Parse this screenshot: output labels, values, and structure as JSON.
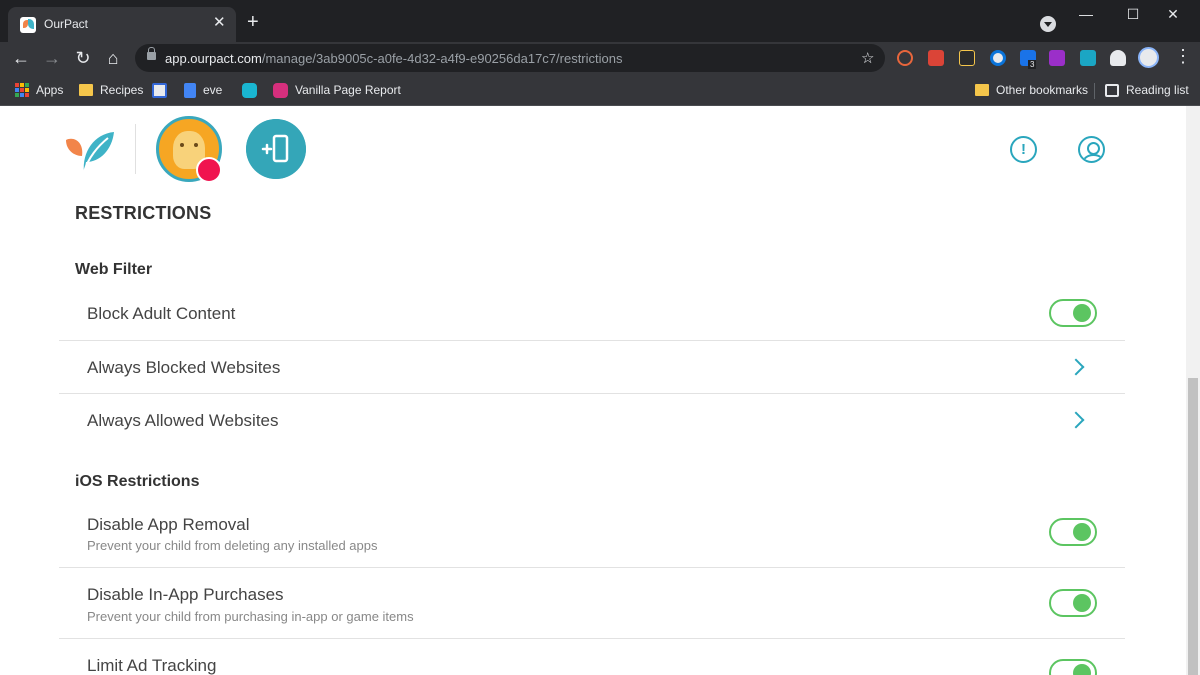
{
  "browser": {
    "tab_title": "OurPact",
    "tab_close": "✕",
    "new_tab": "+",
    "url_host": "app.ourpact.com",
    "url_path": "/manage/3ab9005c-a0fe-4d32-a4f9-e90256da17c7/restrictions",
    "extension_badge": "3",
    "window_controls": {
      "minimize": "—",
      "maximize": "☐",
      "close": "✕"
    },
    "bookmarks": [
      {
        "label": "Apps",
        "icon": "apps-grid-icon"
      },
      {
        "label": "Recipes",
        "icon": "folder-icon"
      },
      {
        "label": "",
        "icon": "shield-bookmark-icon"
      },
      {
        "label": "eve",
        "icon": "docs-icon"
      },
      {
        "label": "",
        "icon": "search-bookmark-icon"
      },
      {
        "label": "Vanilla Page Report",
        "icon": "report-icon"
      }
    ],
    "other_bookmarks": "Other bookmarks",
    "reading_list": "Reading list"
  },
  "colors": {
    "accent": "#2aa6bd",
    "toggle_on": "#5cc561",
    "badge_red": "#f0144f",
    "logo_orange": "#f2854a",
    "logo_teal": "#3fb3c7"
  },
  "page": {
    "title": "RESTRICTIONS",
    "web_filter": {
      "heading": "Web Filter",
      "items": [
        {
          "label": "Block Adult Content",
          "control": "toggle",
          "on": true
        },
        {
          "label": "Always Blocked Websites",
          "control": "chevron"
        },
        {
          "label": "Always Allowed Websites",
          "control": "chevron"
        }
      ]
    },
    "ios_restrictions": {
      "heading": "iOS Restrictions",
      "items": [
        {
          "label": "Disable App Removal",
          "sub": "Prevent your child from deleting any installed apps",
          "control": "toggle",
          "on": true
        },
        {
          "label": "Disable In-App Purchases",
          "sub": "Prevent your child from purchasing in-app or game items",
          "control": "toggle",
          "on": true
        },
        {
          "label": "Limit Ad Tracking",
          "sub": "",
          "control": "toggle",
          "on": true
        }
      ]
    }
  }
}
